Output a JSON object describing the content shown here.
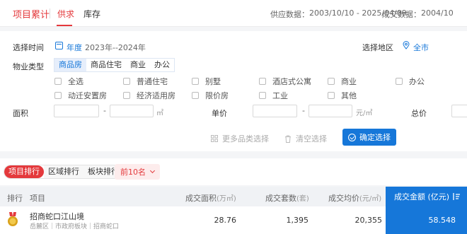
{
  "header": {
    "title": "项目累计",
    "tabs": [
      "供求",
      "库存"
    ],
    "supply_label": "供应数据：",
    "supply_range": "2003/10/10 - 2025/04/09",
    "deal_label": "成交数据：",
    "deal_range": "2004/10"
  },
  "filters": {
    "time_label": "选择时间",
    "time_unit": "年度",
    "time_range": "2023年--2024年",
    "region_label": "选择地区",
    "region_value": "全市",
    "ptype_label": "物业类型",
    "ptype_tabs": [
      "商品房",
      "商品住宅",
      "商业",
      "办公"
    ],
    "ptype_selected": "商品房",
    "checkbox_row1": [
      "全选",
      "普通住宅",
      "别墅",
      "酒店式公寓",
      "商业",
      "办公"
    ],
    "checkbox_row2": [
      "动迁安置房",
      "经济适用房",
      "限价房",
      "工业",
      "其他"
    ],
    "area_label": "面积",
    "area_unit": "㎡",
    "price_label": "单价",
    "price_unit": "元/㎡",
    "total_label": "总价",
    "range_sep": "-",
    "more_label": "更多品类选择",
    "clear_label": "清空选择",
    "confirm_label": "确定选择"
  },
  "ranking": {
    "tabs": [
      "项目排行",
      "区域排行",
      "板块排行"
    ],
    "selected": "项目排行",
    "top_n": "前10名"
  },
  "table": {
    "headers": {
      "rank": "排行",
      "project": "项目",
      "area": "成交面积",
      "area_unit": "(万㎡)",
      "sets": "成交套数",
      "sets_unit": "(套)",
      "avg": "成交均价",
      "avg_unit": "(元/㎡)",
      "amount": "成交金额 (亿元)"
    },
    "rows": [
      {
        "rank": 1,
        "name": "招商蛇口江山境",
        "sub": "岳麓区｜市政府板块｜招商蛇口",
        "area": "28.76",
        "sets": "1,395",
        "avg": "20,355",
        "amount": "58.548"
      }
    ]
  },
  "colors": {
    "accent_red": "#e4393c",
    "accent_blue": "#1677d9",
    "medal": "#d9a21b"
  },
  "icons": [
    "calendar-icon",
    "location-pin-icon",
    "grid-icon",
    "trash-icon",
    "check-circle-icon",
    "chevron-down-icon",
    "medal-icon",
    "sort-icon"
  ]
}
